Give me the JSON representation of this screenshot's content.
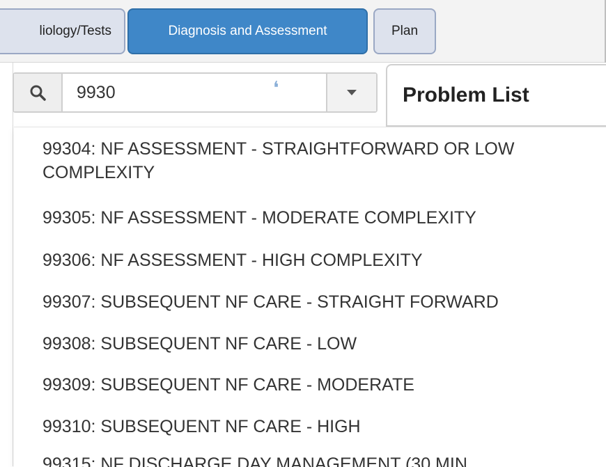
{
  "tabs": [
    {
      "label": "liology/Tests",
      "active": false
    },
    {
      "label": "Diagnosis and Assessment",
      "active": true
    },
    {
      "label": "Plan",
      "active": false
    }
  ],
  "search": {
    "value": "9930",
    "icon": "search-icon",
    "loading_icon": "spinner-icon",
    "dropdown_icon": "chevron-down-icon"
  },
  "problem_list": {
    "title": "Problem List"
  },
  "results": [
    "99304: NF ASSESSMENT - STRAIGHTFORWARD OR LOW COMPLEXITY",
    "99305: NF ASSESSMENT - MODERATE COMPLEXITY",
    "99306: NF ASSESSMENT - HIGH COMPLEXITY",
    "99307: SUBSEQUENT NF CARE - STRAIGHT FORWARD",
    "99308: SUBSEQUENT NF CARE - LOW",
    "99309: SUBSEQUENT NF CARE - MODERATE",
    "99310: SUBSEQUENT NF CARE - HIGH",
    "99315: NF DISCHARGE DAY MANAGEMENT (30 MIN"
  ],
  "colors": {
    "active_tab": "#3f87c8",
    "tab": "#dde2ed",
    "spinner": "#8bb0d8"
  }
}
